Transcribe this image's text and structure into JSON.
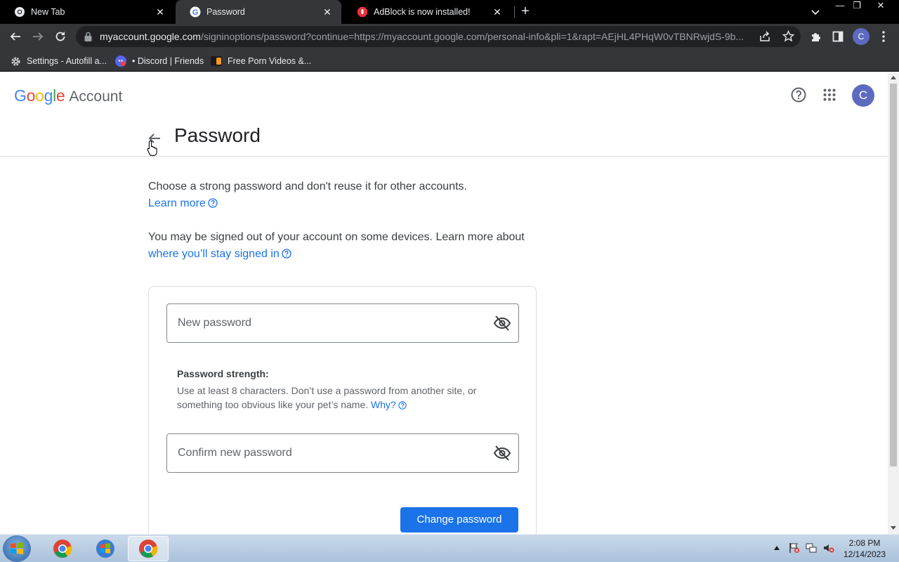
{
  "browser": {
    "tabs": [
      {
        "title": "New Tab",
        "active": false
      },
      {
        "title": "Password",
        "active": true
      },
      {
        "title": "AdBlock is now installed!",
        "active": false
      }
    ],
    "url_host": "myaccount.google.com",
    "url_path": "/signinoptions/password?continue=https://myaccount.google.com/personal-info&pli=1&rapt=AEjHL4PHqW0vTBNRwjdS-9b...",
    "profile_initial": "C",
    "bookmarks": [
      {
        "label": "Settings - Autofill a...",
        "icon": "gear-icon"
      },
      {
        "label": "• Discord | Friends",
        "icon": "discord-icon"
      },
      {
        "label": "Free Porn Videos &...",
        "icon": "site-icon"
      }
    ]
  },
  "header": {
    "logo_word": "Google",
    "logo_suffix": "Account",
    "avatar_initial": "C"
  },
  "main": {
    "title": "Password",
    "intro": "Choose a strong password and don't reuse it for other accounts.",
    "learn_more": "Learn more",
    "signout_text": "You may be signed out of your account on some devices. Learn more about",
    "signout_link": "where you’ll stay signed in",
    "new_password_placeholder": "New password",
    "new_password_value": "",
    "strength_label": "Password strength:",
    "strength_text": "Use at least 8 characters. Don’t use a password from another site, or something too obvious like your pet’s name.",
    "why_link": "Why?",
    "confirm_placeholder": "Confirm new password",
    "confirm_value": "",
    "submit_label": "Change password"
  },
  "taskbar": {
    "time": "2:08 PM",
    "date": "12/14/2023"
  },
  "colors": {
    "link": "#1a73e8",
    "primary_button": "#1a73e8",
    "avatar": "#5c6bc0"
  }
}
